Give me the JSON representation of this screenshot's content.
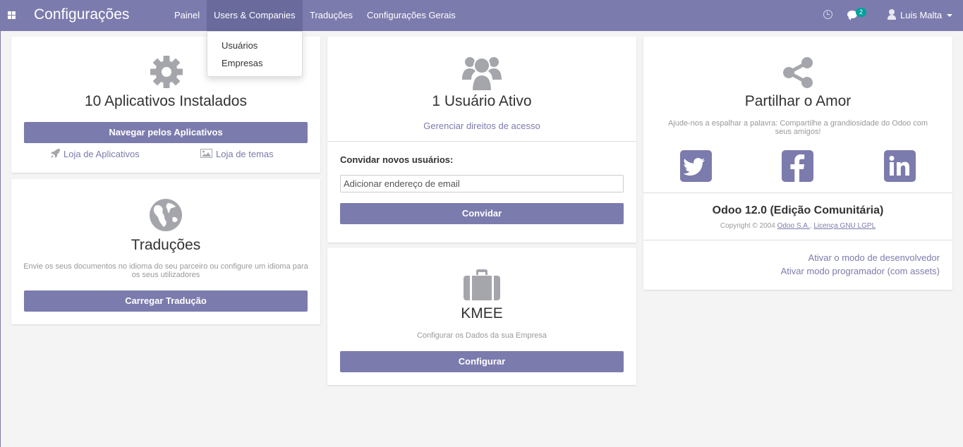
{
  "navbar": {
    "brand": "Configurações",
    "menu": [
      "Painel",
      "Users & Companies",
      "Traduções",
      "Configurações Gerais"
    ],
    "chat_badge": "2",
    "user_name": "Luis Malta"
  },
  "dropdown": {
    "items": [
      "Usuários",
      "Empresas"
    ]
  },
  "apps_card": {
    "title": "10 Aplicativos Instalados",
    "button": "Navegar pelos Aplicativos",
    "link_store": "Loja de Aplicativos",
    "link_themes": "Loja de temas"
  },
  "translations_card": {
    "title": "Traduções",
    "description": "Envie os seus documentos no idioma do seu parceiro ou configure um idioma para os seus utilizadores",
    "button": "Carregar Tradução"
  },
  "users_card": {
    "title": "1 Usuário Ativo",
    "link_access": "Gerenciar direitos de acesso",
    "invite_label": "Convidar novos usuários:",
    "email_placeholder": "Adicionar endereço de email",
    "button": "Convidar"
  },
  "company_card": {
    "title": "KMEE",
    "description": "Configurar os Dados da sua Empresa",
    "button": "Configurar"
  },
  "share_card": {
    "title": "Partilhar o Amor",
    "description": "Ajude-nos a espalhar a palavra: Compartilhe a grandiosidade do Odoo com seus amigos!",
    "version": "Odoo 12.0 (Edição Comunitária)",
    "copyright_prefix": "Copyright © 2004",
    "copyright_company": "Odoo S.A.",
    "license": "Licença GNU LGPL",
    "dev_mode": "Ativar o modo de desenvolvedor",
    "dev_mode_assets": "Ativar modo programador (com assets)"
  },
  "colors": {
    "brand": "#7c7bad",
    "badge": "#00a09d",
    "icon_grey": "#a5a6ac"
  },
  "icons": [
    "apps-icon",
    "clock-icon",
    "chat-icon",
    "user-icon",
    "caret-down-icon",
    "gear-icon",
    "rocket-icon",
    "image-icon",
    "globe-icon",
    "users-icon",
    "briefcase-icon",
    "share-icon",
    "twitter-icon",
    "facebook-icon",
    "linkedin-icon"
  ]
}
